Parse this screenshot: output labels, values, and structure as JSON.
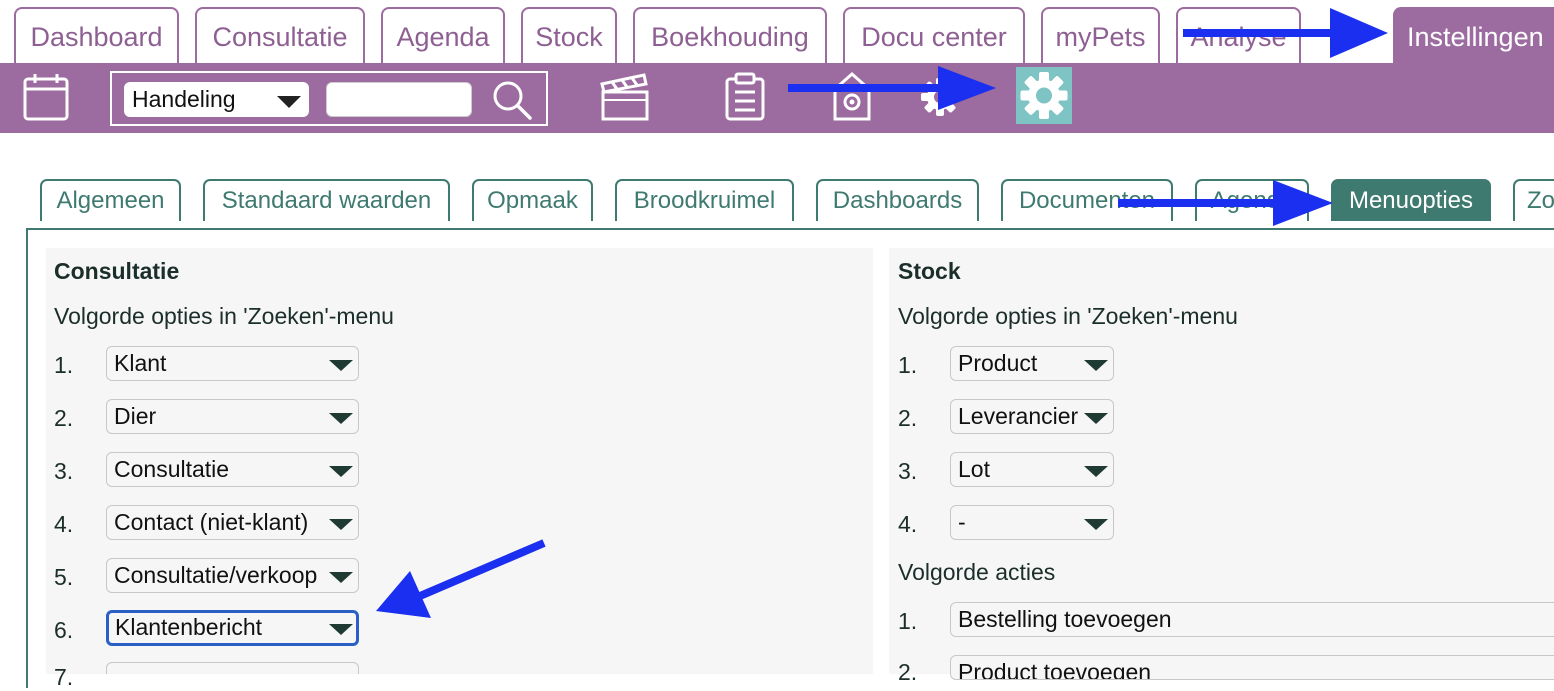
{
  "top_tabs": [
    {
      "label": "Dashboard"
    },
    {
      "label": "Consultatie"
    },
    {
      "label": "Agenda"
    },
    {
      "label": "Stock"
    },
    {
      "label": "Boekhouding"
    },
    {
      "label": "Docu center"
    },
    {
      "label": "myPets"
    },
    {
      "label": "Analyse"
    },
    {
      "label": "Instellingen"
    }
  ],
  "toolbar": {
    "search_select_value": "Handeling",
    "search_input_value": "",
    "icons": [
      "calendar-icon",
      "search-icon",
      "clapperboard-icon",
      "clipboard-icon",
      "house-gear-icon",
      "gear-icon",
      "settings-gear-icon"
    ]
  },
  "sub_tabs": [
    {
      "label": "Algemeen"
    },
    {
      "label": "Standaard waarden"
    },
    {
      "label": "Opmaak"
    },
    {
      "label": "Broodkruimel"
    },
    {
      "label": "Dashboards"
    },
    {
      "label": "Documenten"
    },
    {
      "label": "Agenda"
    },
    {
      "label": "Menuopties"
    },
    {
      "label": "Zo"
    }
  ],
  "consultatie": {
    "title": "Consultatie",
    "subtitle": "Volgorde opties in 'Zoeken'-menu",
    "options": [
      {
        "num": "1.",
        "value": "Klant"
      },
      {
        "num": "2.",
        "value": "Dier"
      },
      {
        "num": "3.",
        "value": "Consultatie"
      },
      {
        "num": "4.",
        "value": "Contact (niet-klant)"
      },
      {
        "num": "5.",
        "value": "Consultatie/verkoop"
      },
      {
        "num": "6.",
        "value": "Klantenbericht"
      },
      {
        "num": "7.",
        "value": ""
      }
    ]
  },
  "stock": {
    "title": "Stock",
    "subtitle": "Volgorde opties in 'Zoeken'-menu",
    "options": [
      {
        "num": "1.",
        "value": "Product"
      },
      {
        "num": "2.",
        "value": "Leverancier"
      },
      {
        "num": "3.",
        "value": "Lot"
      },
      {
        "num": "4.",
        "value": "-"
      }
    ],
    "actions_title": "Volgorde acties",
    "actions": [
      {
        "num": "1.",
        "value": "Bestelling toevoegen"
      },
      {
        "num": "2.",
        "value": "Product toevoegen"
      }
    ]
  },
  "colors": {
    "brand_purple": "#9c6b9f",
    "teal": "#3f7a70",
    "active_gear_bg": "#7fc4c4",
    "annotation_arrow": "#1a2ff0",
    "focus_border": "#2a5fc4"
  }
}
